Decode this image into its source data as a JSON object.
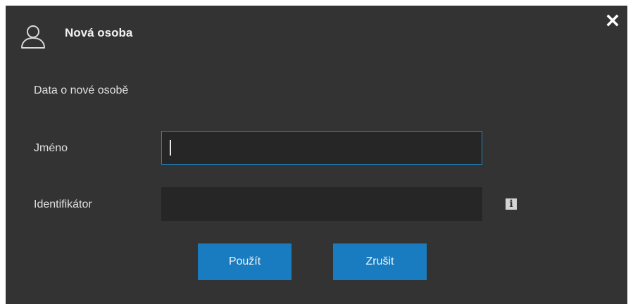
{
  "dialog": {
    "title": "Nová osoba",
    "icon": "person-icon",
    "close_icon": "close-icon"
  },
  "form": {
    "section_label": "Data o nové osobě",
    "name_label": "Jméno",
    "name_value": "",
    "identifier_label": "Identifikátor",
    "identifier_value": "",
    "info_icon_glyph": "i"
  },
  "buttons": {
    "apply_label": "Použít",
    "cancel_label": "Zrušit"
  },
  "colors": {
    "dialog_bg": "#333333",
    "input_bg": "#262626",
    "focus_border": "#1c86c8",
    "button_bg": "#1a7cc0"
  }
}
